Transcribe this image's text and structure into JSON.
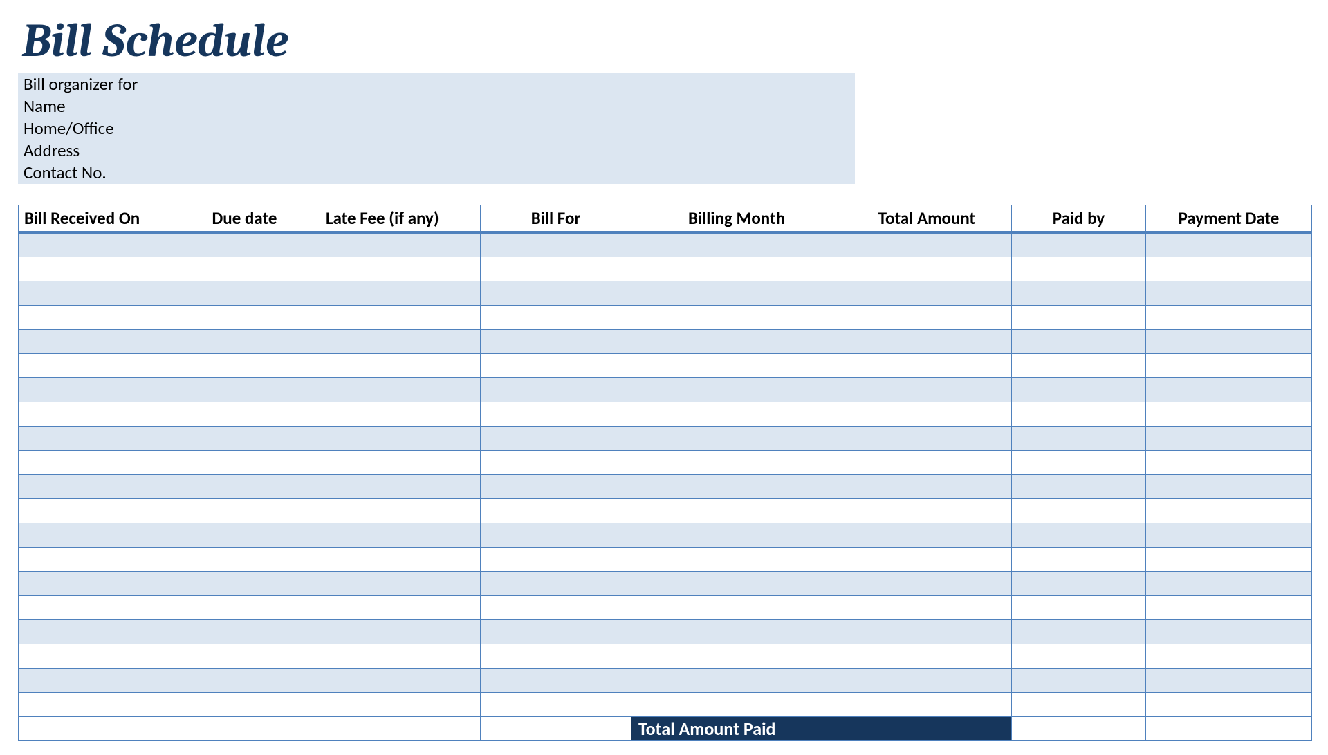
{
  "title": "Bill Schedule",
  "info": {
    "organizer_for": "Bill organizer for",
    "name": "Name",
    "home_office": "Home/Office",
    "address": "Address",
    "contact_no": "Contact No."
  },
  "table": {
    "headers": {
      "received_on": "Bill Received On",
      "due_date": "Due date",
      "late_fee": "Late Fee (if any)",
      "bill_for": "Bill For",
      "billing_month": "Billing Month",
      "total_amount": "Total Amount",
      "paid_by": "Paid by",
      "payment_date": "Payment Date"
    },
    "row_count": 20,
    "total_label": "Total  Amount Paid",
    "total_value": ""
  }
}
